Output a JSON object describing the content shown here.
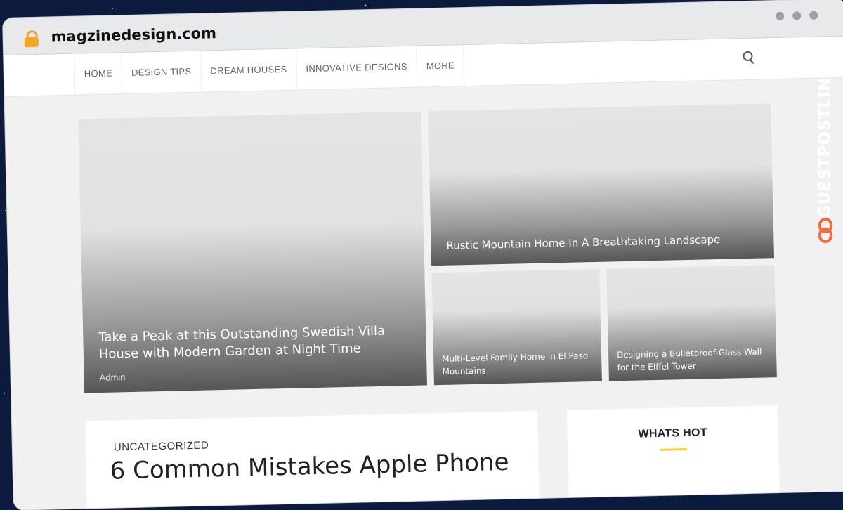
{
  "browser": {
    "url": "magzinedesign.com",
    "icons": {
      "lock": "lock-icon",
      "window_dots": "window-controls"
    }
  },
  "nav": {
    "items": [
      "HOME",
      "DESIGN TIPS",
      "DREAM HOUSES",
      "INNOVATIVE DESIGNS",
      "MORE"
    ],
    "search_icon": "search-icon"
  },
  "featured": {
    "main": {
      "title": "Take a Peak at this Outstanding Swedish Villa House with Modern Garden at Night Time",
      "author": "Admin"
    },
    "top_right": {
      "title": "Rustic Mountain Home In A Breathtaking Landscape"
    },
    "bottom_left": {
      "title": "Multi-Level Family Home in El Paso Mountains"
    },
    "bottom_right": {
      "title": "Designing a Bulletproof-Glass Wall for the Eiffel Tower"
    }
  },
  "article": {
    "category": "UNCATEGORIZED",
    "title": "6 Common Mistakes Apple Phone"
  },
  "sidebar": {
    "widget_title": "WHATS HOT"
  },
  "brand": {
    "name": "GUESTPOSTLINKS",
    "icon": "chain-link-icon"
  },
  "colors": {
    "accent": "#f4d03f",
    "lock": "#f5a623",
    "brand_icon": "#f26a3d"
  }
}
